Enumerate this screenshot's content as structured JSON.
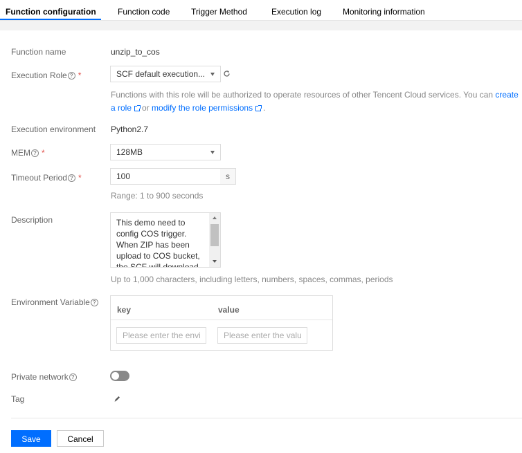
{
  "tabs": [
    {
      "label": "Function configuration",
      "active": true
    },
    {
      "label": "Function code",
      "active": false
    },
    {
      "label": "Trigger Method",
      "active": false
    },
    {
      "label": "Execution log",
      "active": false
    },
    {
      "label": "Monitoring information",
      "active": false
    }
  ],
  "form": {
    "function_name": {
      "label": "Function name",
      "value": "unzip_to_cos"
    },
    "execution_role": {
      "label": "Execution Role",
      "required_mark": "*",
      "selected": "SCF default execution...",
      "hint_prefix": "Functions with this role will be authorized to operate resources of other Tencent Cloud services. You can ",
      "hint_link1_part1": "create",
      "hint_link1_part2": "a role",
      "hint_or": "or",
      "hint_link2": "modify the role permissions",
      "hint_end": "."
    },
    "execution_environment": {
      "label": "Execution environment",
      "value": "Python2.7"
    },
    "mem": {
      "label": "MEM",
      "required_mark": "*",
      "selected": "128MB"
    },
    "timeout": {
      "label": "Timeout Period",
      "required_mark": "*",
      "value": "100",
      "unit": "s",
      "hint": "Range: 1 to 900 seconds"
    },
    "description": {
      "label": "Description",
      "lines": [
        "This demo need to",
        "config COS trigger.",
        "When ZIP has been",
        "upload to COS bucket,",
        "the SCF will download"
      ],
      "hint": "Up to 1,000 characters, including letters, numbers, spaces, commas, periods"
    },
    "env_vars": {
      "label": "Environment Variable",
      "col_key": "key",
      "col_value": "value",
      "key_placeholder": "Please enter the envir",
      "value_placeholder": "Please enter the value"
    },
    "private_network": {
      "label": "Private network",
      "enabled": false
    },
    "tag": {
      "label": "Tag"
    }
  },
  "buttons": {
    "save": "Save",
    "cancel": "Cancel"
  },
  "colors": {
    "accent": "#006eff",
    "required": "#e1504a"
  }
}
